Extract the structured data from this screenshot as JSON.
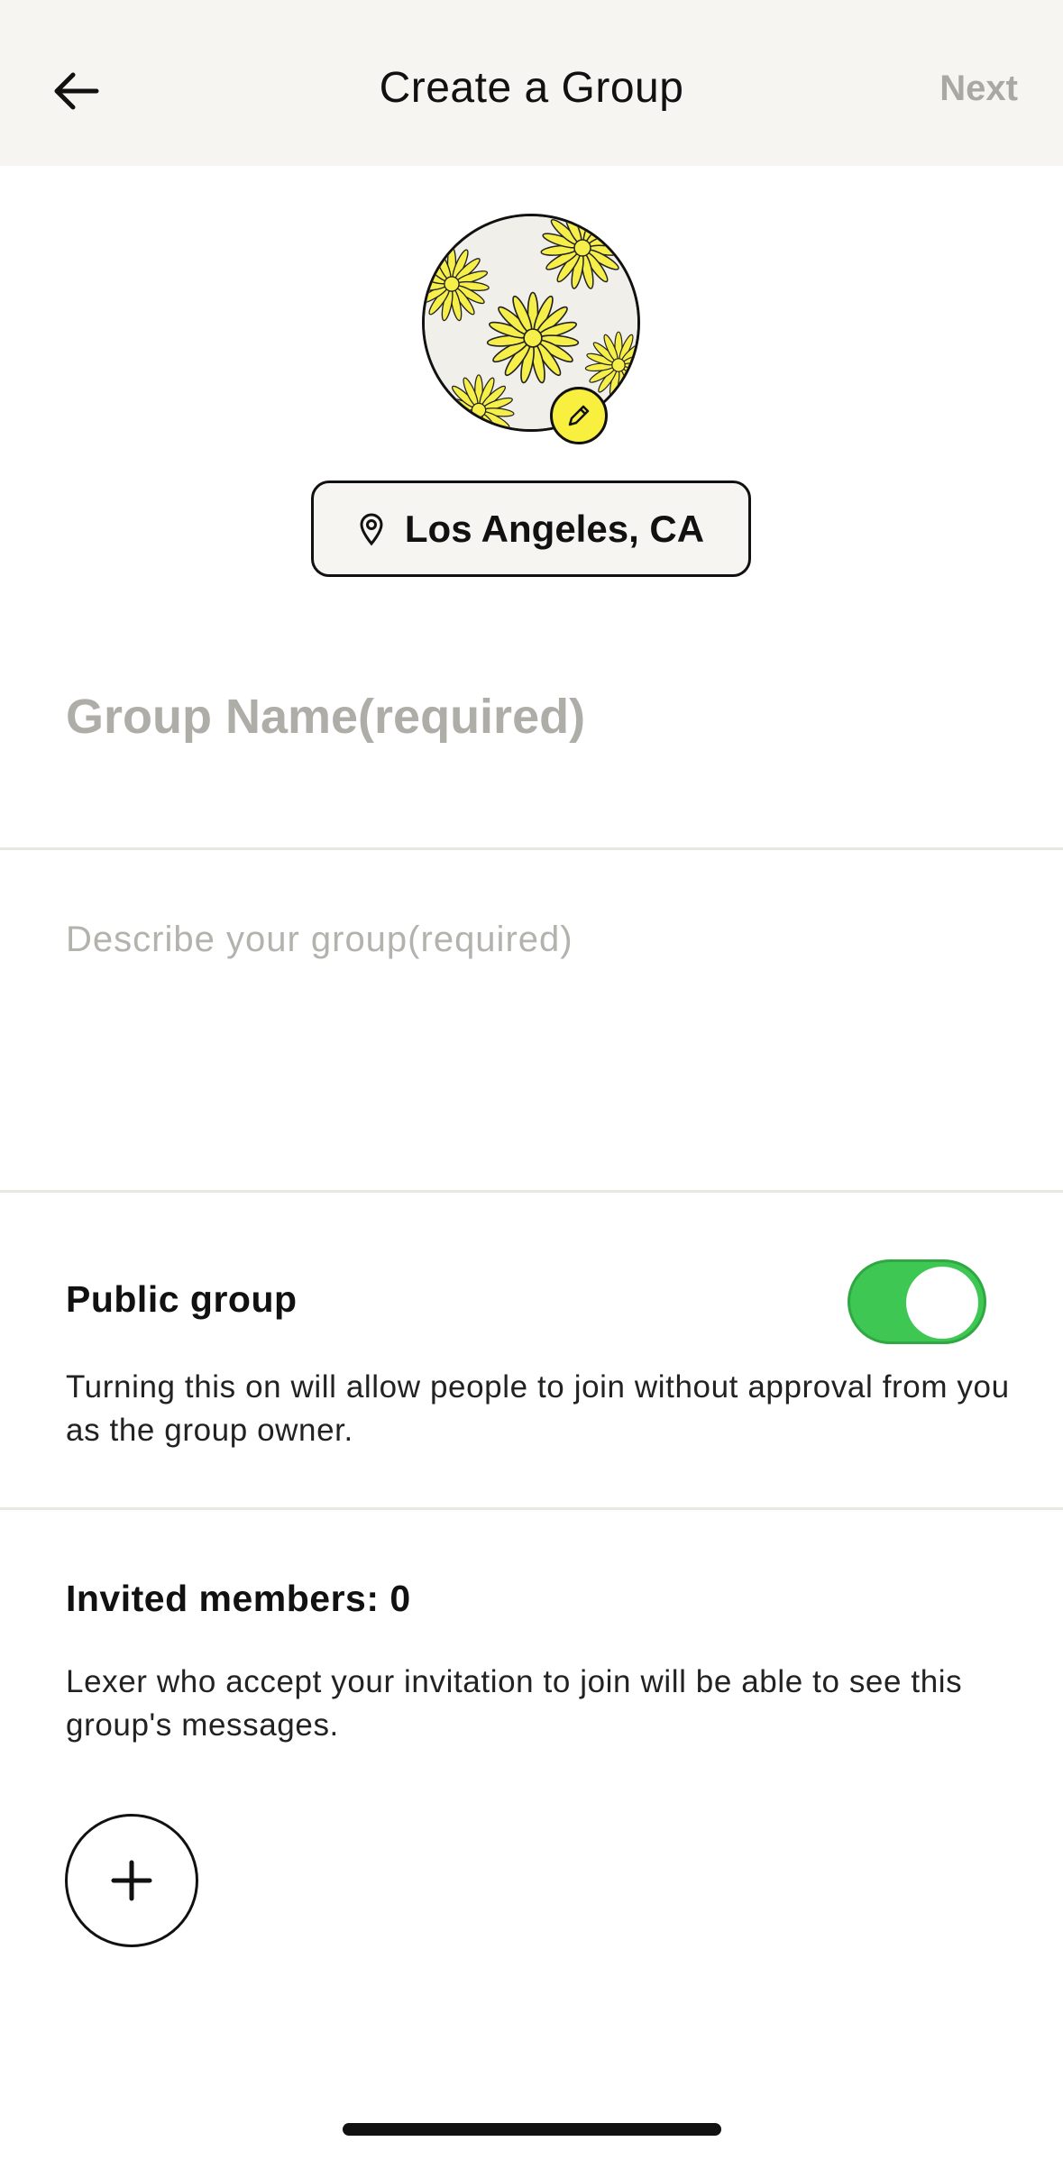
{
  "header": {
    "title": "Create a Group",
    "back_icon": "arrow-left-icon",
    "next_label": "Next"
  },
  "avatar": {
    "image": "yellow-flowers-pattern",
    "edit_icon": "pencil-icon",
    "badge_color": "#f9ef3f"
  },
  "location": {
    "icon": "map-pin-icon",
    "label": "Los Angeles, CA"
  },
  "form": {
    "name_placeholder": "Group Name(required)",
    "name_value": "",
    "description_placeholder": "Describe your group(required)",
    "description_value": ""
  },
  "public_group": {
    "title": "Public group",
    "description": "Turning this on will allow people to join without approval from you as the group owner.",
    "enabled": true,
    "toggle_color": "#3ec753"
  },
  "invited": {
    "title": "Invited members: 0",
    "description": "Lexer who accept your invitation to join will be able to see this group's messages.",
    "add_icon": "plus-icon"
  },
  "colors": {
    "header_bg": "#f6f5f1",
    "accent_yellow": "#f9ef3f",
    "toggle_on": "#3ec753",
    "placeholder": "#aeada8"
  }
}
